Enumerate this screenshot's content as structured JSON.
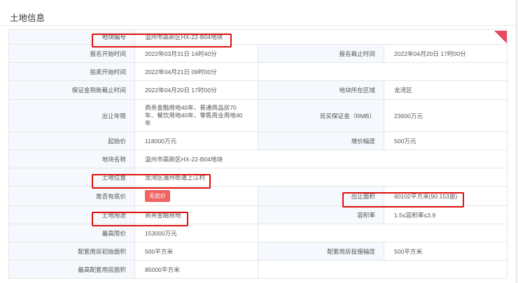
{
  "page": {
    "title": "土地信息"
  },
  "rows": [
    [
      {
        "label": "地块编号",
        "value": "温州市高新区HX-22-B04地块"
      }
    ],
    [
      {
        "label": "报名开始时间",
        "value": "2022年03月31日 14时40分"
      },
      {
        "label": "报名截止时间",
        "value": "2022年04月20日 17时00分"
      }
    ],
    [
      {
        "label": "拍卖开始时间",
        "value": "2022年04月21日 09时00分"
      }
    ],
    [
      {
        "label": "保证金到账截止时间",
        "value": "2022年04月20日 17时00分"
      },
      {
        "label": "地块所在区域",
        "value": "龙湾区"
      }
    ],
    [
      {
        "label": "出让年限",
        "value": "商务金融用地40年、普通商品房70年、餐饮用地40年、零售商业用地40年"
      },
      {
        "label": "竞买保证金（RMB）",
        "value": "23600万元"
      }
    ],
    [
      {
        "label": "起始价",
        "value": "118000万元"
      },
      {
        "label": "增价幅度",
        "value": "500万元"
      }
    ],
    [
      {
        "label": "地块名称",
        "value": "温州市高新区HX-22-B04地块"
      }
    ],
    [
      {
        "label": "土地位置",
        "value": "龙湾区蒲州街道上江村"
      }
    ],
    [
      {
        "label": "是否有底价",
        "value": "无底价"
      },
      {
        "label": "出让面积",
        "value": "60102平方米(90.153亩)"
      }
    ],
    [
      {
        "label": "土地用途",
        "value": "商务金融用地"
      },
      {
        "label": "容积率",
        "value": "1.5≤容积率≤3.9"
      }
    ],
    [
      {
        "label": "最高限价",
        "value": "153000万元"
      }
    ],
    [
      {
        "label": "配套用房初始面积",
        "value": "500平方米"
      },
      {
        "label": "配套用房投报幅度",
        "value": "500平方米"
      }
    ],
    [
      {
        "label": "最高配套用房面积",
        "value": "85000平方米"
      }
    ]
  ],
  "colors": {
    "highlight": "#e01010",
    "badge": "#f06262",
    "label_bg": "#f5f8fc",
    "ribbon": "#e84a5f"
  }
}
